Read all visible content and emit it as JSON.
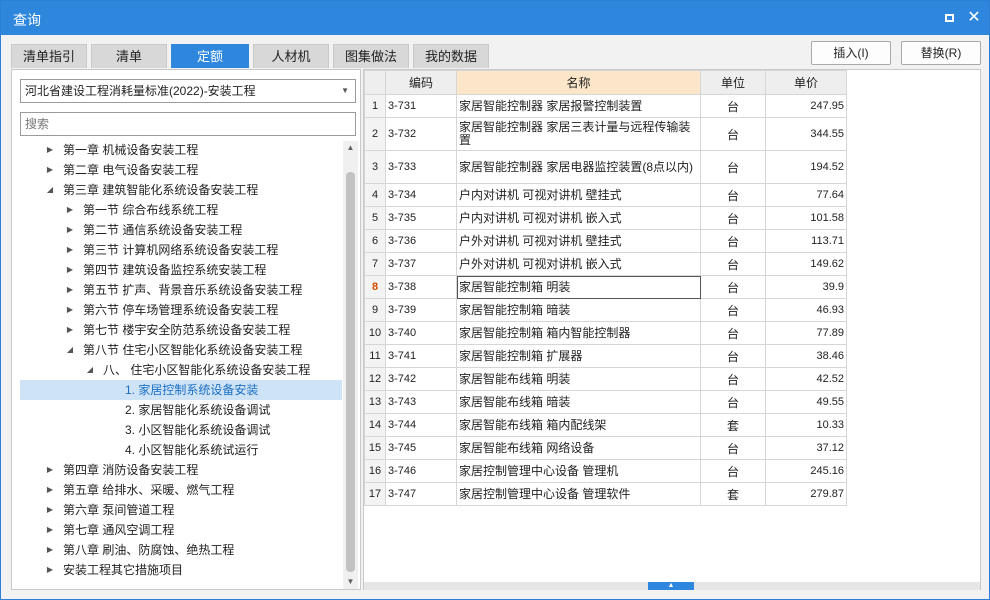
{
  "window": {
    "title": "查询"
  },
  "tabs": [
    {
      "label": "清单指引"
    },
    {
      "label": "清单"
    },
    {
      "label": "定额",
      "active": true
    },
    {
      "label": "人材机"
    },
    {
      "label": "图集做法"
    },
    {
      "label": "我的数据"
    }
  ],
  "buttons": {
    "insert": "插入(I)",
    "replace": "替换(R)"
  },
  "left": {
    "library": "河北省建设工程消耗量标准(2022)-安装工程",
    "search_placeholder": "搜索",
    "tree": [
      {
        "label": "第一章 机械设备安装工程",
        "level": 0,
        "state": "collapsed"
      },
      {
        "label": "第二章 电气设备安装工程",
        "level": 0,
        "state": "collapsed"
      },
      {
        "label": "第三章 建筑智能化系统设备安装工程",
        "level": 0,
        "state": "expanded"
      },
      {
        "label": "第一节 综合布线系统工程",
        "level": 1,
        "state": "collapsed"
      },
      {
        "label": "第二节 通信系统设备安装工程",
        "level": 1,
        "state": "collapsed"
      },
      {
        "label": "第三节 计算机网络系统设备安装工程",
        "level": 1,
        "state": "collapsed"
      },
      {
        "label": "第四节 建筑设备监控系统安装工程",
        "level": 1,
        "state": "collapsed"
      },
      {
        "label": "第五节 扩声、背景音乐系统设备安装工程",
        "level": 1,
        "state": "collapsed"
      },
      {
        "label": "第六节 停车场管理系统设备安装工程",
        "level": 1,
        "state": "collapsed"
      },
      {
        "label": "第七节 楼宇安全防范系统设备安装工程",
        "level": 1,
        "state": "collapsed"
      },
      {
        "label": "第八节 住宅小区智能化系统设备安装工程",
        "level": 1,
        "state": "expanded"
      },
      {
        "label": "八、 住宅小区智能化系统设备安装工程",
        "level": 2,
        "state": "expanded"
      },
      {
        "label": "1. 家居控制系统设备安装",
        "level": 3,
        "state": "leaf",
        "selected": true
      },
      {
        "label": "2. 家居智能化系统设备调试",
        "level": 3,
        "state": "leaf"
      },
      {
        "label": "3. 小区智能化系统设备调试",
        "level": 3,
        "state": "leaf"
      },
      {
        "label": "4. 小区智能化系统试运行",
        "level": 3,
        "state": "leaf"
      },
      {
        "label": "第四章 消防设备安装工程",
        "level": 0,
        "state": "collapsed"
      },
      {
        "label": "第五章 给排水、采暖、燃气工程",
        "level": 0,
        "state": "collapsed"
      },
      {
        "label": "第六章 泵间管道工程",
        "level": 0,
        "state": "collapsed"
      },
      {
        "label": "第七章 通风空调工程",
        "level": 0,
        "state": "collapsed"
      },
      {
        "label": "第八章 刷油、防腐蚀、绝热工程",
        "level": 0,
        "state": "collapsed"
      },
      {
        "label": "安装工程其它措施项目",
        "level": 0,
        "state": "collapsed"
      }
    ]
  },
  "table": {
    "headers": {
      "num": "",
      "code": "编码",
      "name": "名称",
      "unit": "单位",
      "price": "单价"
    },
    "active_row": 8,
    "rows": [
      {
        "num": "1",
        "code": "3-731",
        "name": "家居智能控制器 家居报警控制装置",
        "unit": "台",
        "price": "247.95"
      },
      {
        "num": "2",
        "code": "3-732",
        "name": "家居智能控制器 家居三表计量与远程传输装置",
        "unit": "台",
        "price": "344.55"
      },
      {
        "num": "3",
        "code": "3-733",
        "name": "家居智能控制器 家居电器监控装置(8点以内)",
        "unit": "台",
        "price": "194.52"
      },
      {
        "num": "4",
        "code": "3-734",
        "name": "户内对讲机 可视对讲机 壁挂式",
        "unit": "台",
        "price": "77.64"
      },
      {
        "num": "5",
        "code": "3-735",
        "name": "户内对讲机 可视对讲机 嵌入式",
        "unit": "台",
        "price": "101.58"
      },
      {
        "num": "6",
        "code": "3-736",
        "name": "户外对讲机 可视对讲机 壁挂式",
        "unit": "台",
        "price": "113.71"
      },
      {
        "num": "7",
        "code": "3-737",
        "name": "户外对讲机 可视对讲机 嵌入式",
        "unit": "台",
        "price": "149.62"
      },
      {
        "num": "8",
        "code": "3-738",
        "name": "家居智能控制箱 明装",
        "unit": "台",
        "price": "39.9"
      },
      {
        "num": "9",
        "code": "3-739",
        "name": "家居智能控制箱 暗装",
        "unit": "台",
        "price": "46.93"
      },
      {
        "num": "10",
        "code": "3-740",
        "name": "家居智能控制箱 箱内智能控制器",
        "unit": "台",
        "price": "77.89"
      },
      {
        "num": "11",
        "code": "3-741",
        "name": "家居智能控制箱 扩展器",
        "unit": "台",
        "price": "38.46"
      },
      {
        "num": "12",
        "code": "3-742",
        "name": "家居智能布线箱 明装",
        "unit": "台",
        "price": "42.52"
      },
      {
        "num": "13",
        "code": "3-743",
        "name": "家居智能布线箱 暗装",
        "unit": "台",
        "price": "49.55"
      },
      {
        "num": "14",
        "code": "3-744",
        "name": "家居智能布线箱 箱内配线架",
        "unit": "套",
        "price": "10.33"
      },
      {
        "num": "15",
        "code": "3-745",
        "name": "家居智能布线箱 网络设备",
        "unit": "台",
        "price": "37.12"
      },
      {
        "num": "16",
        "code": "3-746",
        "name": "家居控制管理中心设备 管理机",
        "unit": "台",
        "price": "245.16"
      },
      {
        "num": "17",
        "code": "3-747",
        "name": "家居控制管理中心设备 管理软件",
        "unit": "套",
        "price": "279.87"
      }
    ]
  },
  "colors": {
    "accent": "#2e87dc",
    "selected_bg": "#cfe3f7",
    "header_highlight": "#fbe6c9",
    "active_row_number": "#d04a00"
  }
}
